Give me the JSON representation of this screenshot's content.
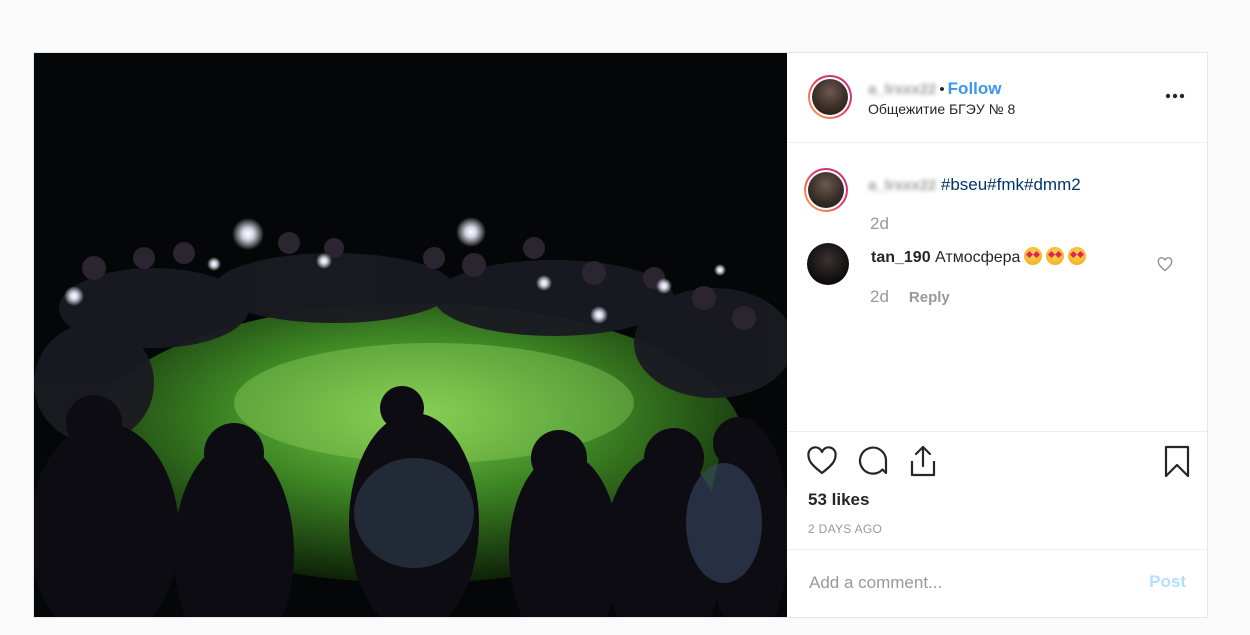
{
  "header": {
    "username": "a_lrxxx22",
    "separator": "•",
    "follow_label": "Follow",
    "location": "Общежитие БГЭУ № 8",
    "more_icon": "more-horizontal-icon"
  },
  "caption": {
    "username": "a_lrxxx22",
    "hashtags": "#bseu#fmk#dmm2",
    "time": "2d"
  },
  "comments": [
    {
      "username": "tan_190",
      "text": "Атмосфера",
      "emoji_count": 3,
      "time": "2d",
      "reply_label": "Reply"
    }
  ],
  "actions": {
    "like_icon": "heart-icon",
    "comment_icon": "comment-icon",
    "share_icon": "share-icon",
    "save_icon": "bookmark-icon"
  },
  "likes_text": "53 likes",
  "timestamp": "2 DAYS AGO",
  "add_comment": {
    "placeholder": "Add a comment...",
    "post_label": "Post"
  },
  "colors": {
    "link_blue": "#3897f0",
    "hashtag_blue": "#003569",
    "post_disabled": "#b2dffc",
    "muted": "#999999"
  }
}
